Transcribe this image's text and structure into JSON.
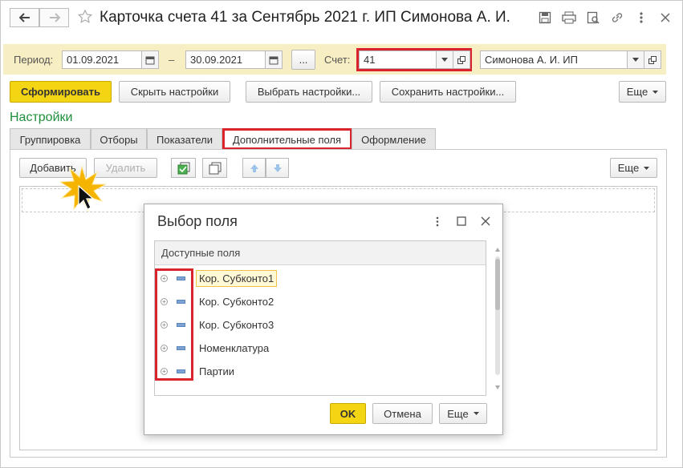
{
  "window": {
    "title": "Карточка счета 41 за Сентябрь 2021 г. ИП Симонова А. И.",
    "icons": [
      "back-arrow-icon",
      "forward-arrow-icon",
      "star-icon",
      "save-icon",
      "print-icon",
      "preview-icon",
      "link-icon",
      "more-icon",
      "close-icon"
    ]
  },
  "params": {
    "period_label": "Период:",
    "date_from": "01.09.2021",
    "dash": "–",
    "date_to": "30.09.2021",
    "ellipsis": "...",
    "account_label": "Счет:",
    "account_value": "41",
    "org_value": "Симонова А. И. ИП"
  },
  "toolbar": {
    "generate": "Сформировать",
    "hide_settings": "Скрыть настройки",
    "choose_settings": "Выбрать настройки...",
    "save_settings": "Сохранить настройки...",
    "more": "Еще"
  },
  "settings": {
    "heading": "Настройки",
    "tabs": [
      "Группировка",
      "Отборы",
      "Показатели",
      "Дополнительные поля",
      "Оформление"
    ],
    "active_tab": "Дополнительные поля",
    "add": "Добавить",
    "delete": "Удалить",
    "more": "Еще"
  },
  "dialog": {
    "title": "Выбор поля",
    "list_header": "Доступные поля",
    "items": [
      "Кор. Субконто1",
      "Кор. Субконто2",
      "Кор. Субконто3",
      "Номенклатура",
      "Партии"
    ],
    "selected": "Кор. Субконто1",
    "ok": "OK",
    "cancel": "Отмена",
    "more": "Еще"
  },
  "colors": {
    "accent_yellow": "#f4d513",
    "params_bar": "#f7eec3",
    "highlight_red": "#d9232d",
    "settings_green": "#1d8f3c"
  }
}
